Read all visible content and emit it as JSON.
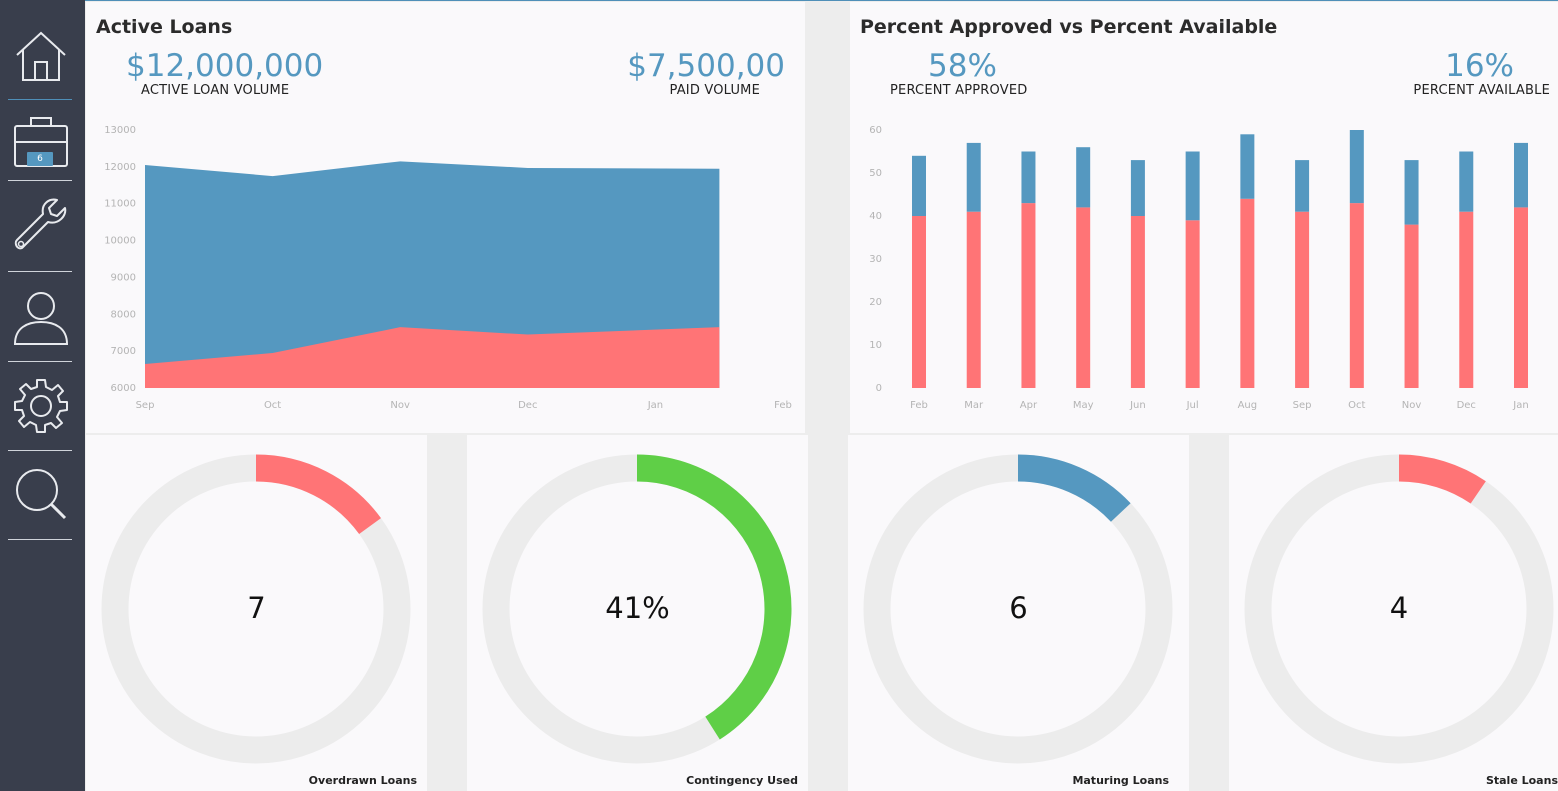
{
  "sidebar": {
    "items": [
      {
        "icon": "home-icon",
        "label": ""
      },
      {
        "icon": "briefcase-icon",
        "badge": "6"
      },
      {
        "icon": "wrench-icon"
      },
      {
        "icon": "user-icon"
      },
      {
        "icon": "gear-icon"
      },
      {
        "icon": "search-icon"
      }
    ]
  },
  "colors": {
    "blue": "#5598c0",
    "red": "#ff7476",
    "green": "#5fcf47",
    "track": "#ececec",
    "sidebar": "#393e4c"
  },
  "active_loans": {
    "title": "Active Loans",
    "kpi_left": {
      "value": "$12,000,000",
      "label": "ACTIVE LOAN VOLUME"
    },
    "kpi_right": {
      "value": "$7,500,00",
      "label": "PAID VOLUME"
    }
  },
  "approved": {
    "title": "Percent Approved vs Percent Available",
    "kpi_left": {
      "value": "58%",
      "label": "PERCENT APPROVED"
    },
    "kpi_right": {
      "value": "16%",
      "label": "PERCENT AVAILABLE"
    }
  },
  "chart_data": [
    {
      "type": "area",
      "title": "Active Loans",
      "x": [
        "Sep",
        "Oct",
        "Nov",
        "Dec",
        "Jan",
        "Feb"
      ],
      "yticks": [
        6000,
        7000,
        8000,
        9000,
        10000,
        11000,
        12000,
        13000
      ],
      "ylim": [
        6000,
        13000
      ],
      "grid": false,
      "series": [
        {
          "color": "#5598c0",
          "values": [
            12050,
            11750,
            12150,
            11970,
            11950,
            12050
          ]
        },
        {
          "color": "#ff7476",
          "values": [
            6650,
            6950,
            7650,
            7450,
            7650,
            7550
          ]
        }
      ]
    },
    {
      "type": "bar",
      "title": "Percent Approved vs Percent Available",
      "categories": [
        "Feb",
        "Mar",
        "Apr",
        "May",
        "Jun",
        "Jul",
        "Aug",
        "Sep",
        "Oct",
        "Nov",
        "Dec",
        "Jan"
      ],
      "yticks": [
        0,
        10,
        20,
        30,
        40,
        50,
        60
      ],
      "ylim": [
        0,
        60
      ],
      "stacked": true,
      "grid": false,
      "series": [
        {
          "color": "#ff7476",
          "values": [
            40,
            41,
            43,
            42,
            40,
            39,
            44,
            41,
            43,
            38,
            41,
            42
          ]
        },
        {
          "color": "#5598c0",
          "values": [
            14,
            16,
            12,
            14,
            13,
            16,
            15,
            12,
            17,
            15,
            14,
            15
          ]
        }
      ]
    }
  ],
  "donuts": [
    {
      "label": "Overdrawn Loans",
      "value": "7",
      "fraction": 0.15,
      "color": "#ff7476"
    },
    {
      "label": "Contingency Used",
      "value": "41%",
      "fraction": 0.41,
      "color": "#5fcf47"
    },
    {
      "label": "Maturing Loans",
      "value": "6",
      "fraction": 0.13,
      "color": "#5598c0"
    },
    {
      "label": "Stale Loans",
      "value": "4",
      "fraction": 0.095,
      "color": "#ff7476"
    }
  ]
}
